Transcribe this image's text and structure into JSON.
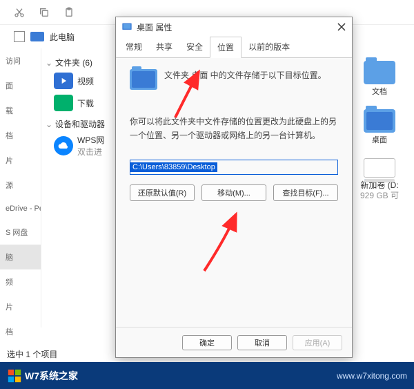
{
  "explorer": {
    "addr_label": "此电脑",
    "leftnav": [
      "访问",
      "面",
      "载",
      "档",
      "片",
      "源",
      "eDrive - Pers",
      "S 网盘",
      "脑",
      "频",
      "片",
      "档"
    ],
    "sel_index": 8,
    "sections": {
      "folders": "文件夹 (6)",
      "drives": "设备和驱动器"
    },
    "tree": {
      "video": "视频",
      "downloads": "下载",
      "wps_title": "WPS网",
      "wps_sub": "双击进"
    },
    "right": {
      "docs": "文档",
      "desktop": "桌面",
      "vol_name": "新加卷 (D:",
      "vol_free": "929 GB 可"
    },
    "status": "选中 1 个项目"
  },
  "dialog": {
    "title": "桌面 属性",
    "tabs": [
      "常规",
      "共享",
      "安全",
      "位置",
      "以前的版本"
    ],
    "active_tab": 3,
    "line1": "文件夹 桌面 中的文件存储于以下目标位置。",
    "line2": "你可以将此文件夹中文件存储的位置更改为此硬盘上的另一个位置、另一个驱动器或网络上的另一台计算机。",
    "path": "C:\\Users\\83859\\Desktop",
    "buttons": {
      "restore": "还原默认值(R)",
      "move": "移动(M)...",
      "find": "查找目标(F)..."
    },
    "footer": {
      "ok": "确定",
      "cancel": "取消",
      "apply": "应用(A)"
    }
  },
  "branding": {
    "name": "W7系统之家",
    "url": "www.w7xitong.com"
  }
}
